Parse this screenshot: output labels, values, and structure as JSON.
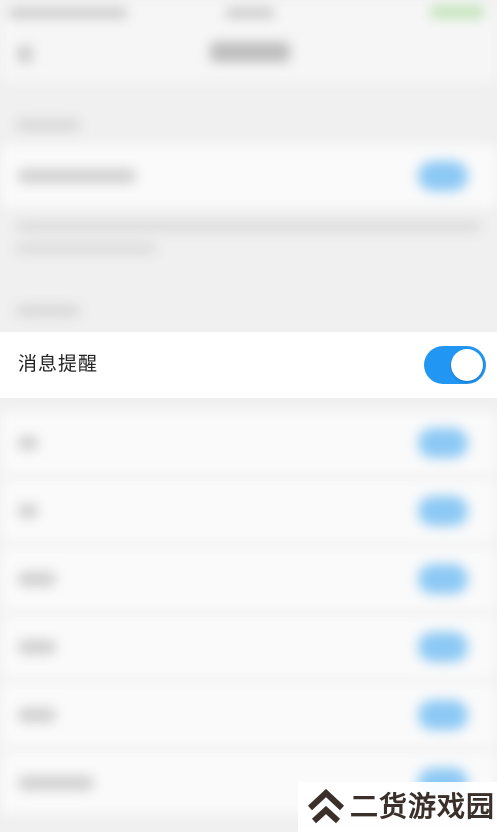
{
  "screen": {
    "blurred_background": true,
    "focused_setting": {
      "label": "消息提醒",
      "toggle_on": true,
      "toggle_color": "#2196f3"
    }
  },
  "watermark": {
    "text": "二货游戏园",
    "logo_icon": "double-chevron-up-icon",
    "color": "#3a2f2a"
  }
}
